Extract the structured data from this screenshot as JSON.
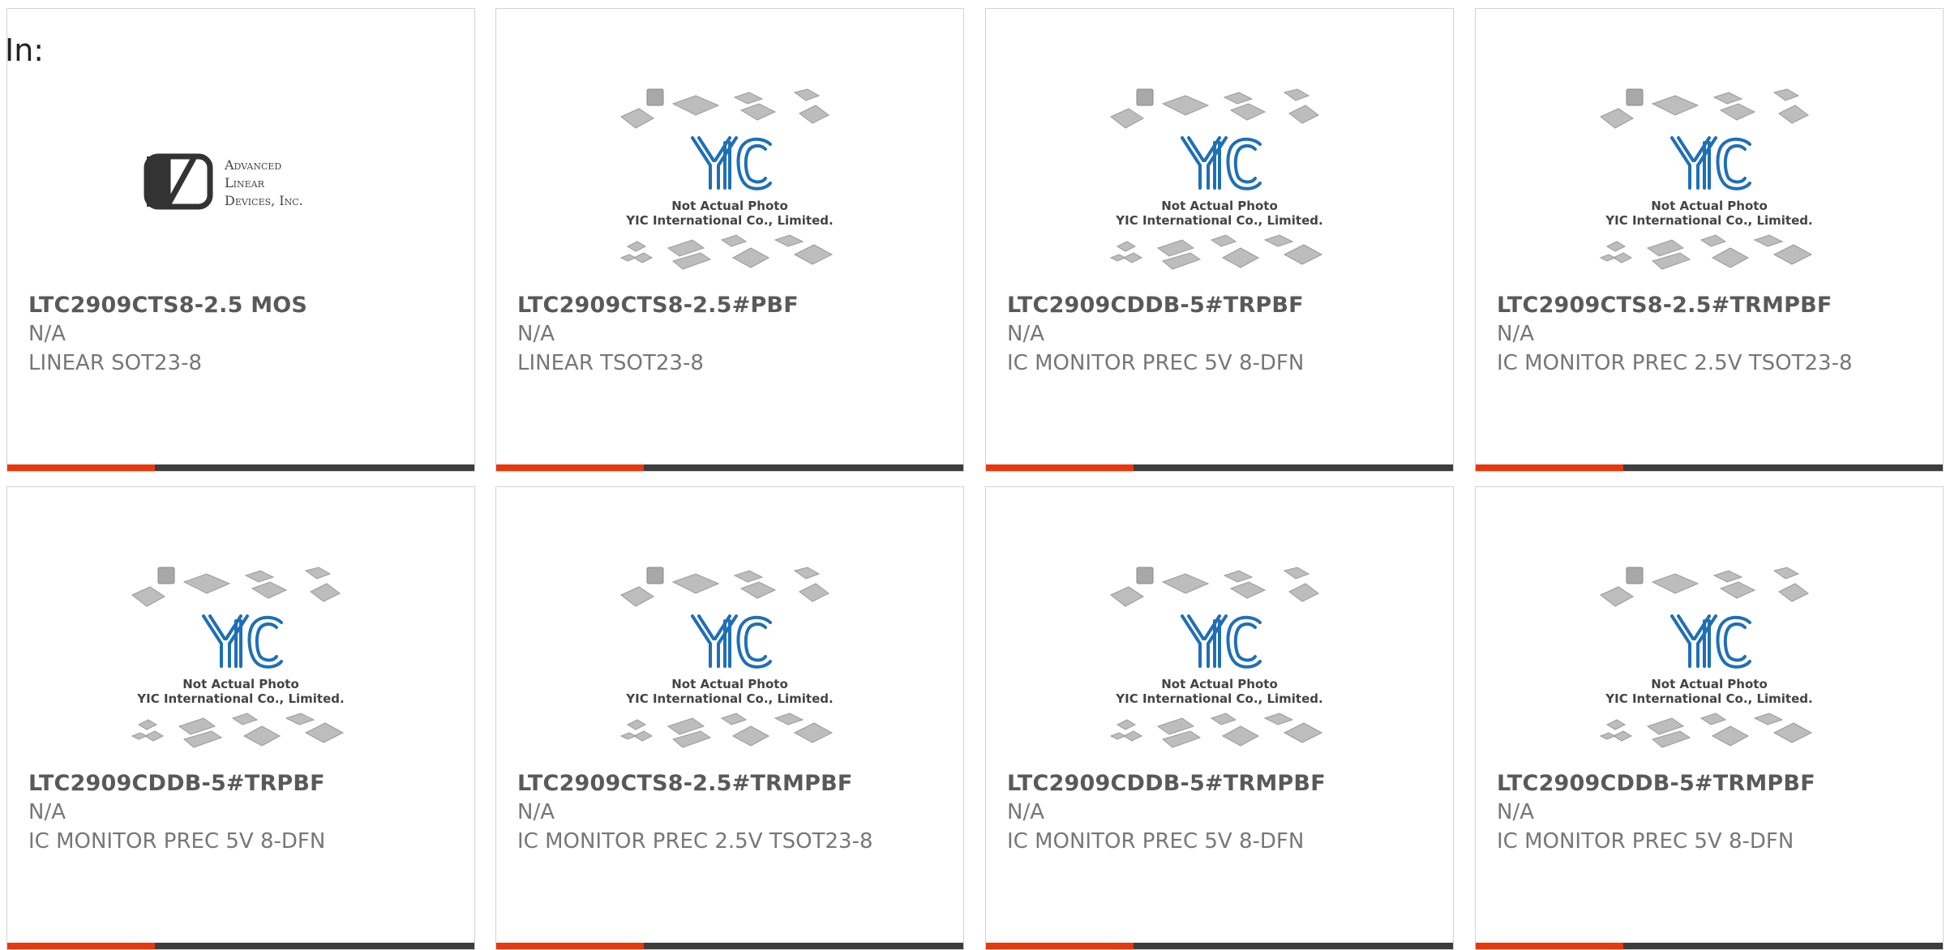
{
  "header": {
    "in_label": "In:"
  },
  "placeholder_image": {
    "line1": "Not Actual Photo",
    "line2": "YIC International Co., Limited.",
    "logo_text": "YIC"
  },
  "adi_logo": {
    "line1": "Advanced",
    "line2": "Linear",
    "line3": "Devices, Inc."
  },
  "colors": {
    "accent": "#e8380d",
    "bar": "#3d3d3d",
    "yic_blue": "#1f6fb5"
  },
  "products": [
    {
      "part": "LTC2909CTS8-2.5 MOS",
      "manufacturer": "N/A",
      "description": "LINEAR SOT23-8",
      "image": "adi-logo"
    },
    {
      "part": "LTC2909CTS8-2.5#PBF",
      "manufacturer": "N/A",
      "description": "LINEAR TSOT23-8",
      "image": "yic-placeholder"
    },
    {
      "part": "LTC2909CDDB-5#TRPBF",
      "manufacturer": "N/A",
      "description": "IC MONITOR PREC 5V 8-DFN",
      "image": "yic-placeholder"
    },
    {
      "part": "LTC2909CTS8-2.5#TRMPBF",
      "manufacturer": "N/A",
      "description": "IC MONITOR PREC 2.5V TSOT23-8",
      "image": "yic-placeholder"
    },
    {
      "part": "LTC2909CDDB-5#TRPBF",
      "manufacturer": "N/A",
      "description": "IC MONITOR PREC 5V 8-DFN",
      "image": "yic-placeholder"
    },
    {
      "part": "LTC2909CTS8-2.5#TRMPBF",
      "manufacturer": "N/A",
      "description": "IC MONITOR PREC 2.5V TSOT23-8",
      "image": "yic-placeholder"
    },
    {
      "part": "LTC2909CDDB-5#TRMPBF",
      "manufacturer": "N/A",
      "description": "IC MONITOR PREC 5V 8-DFN",
      "image": "yic-placeholder"
    },
    {
      "part": "LTC2909CDDB-5#TRMPBF",
      "manufacturer": "N/A",
      "description": "IC MONITOR PREC 5V 8-DFN",
      "image": "yic-placeholder"
    }
  ]
}
